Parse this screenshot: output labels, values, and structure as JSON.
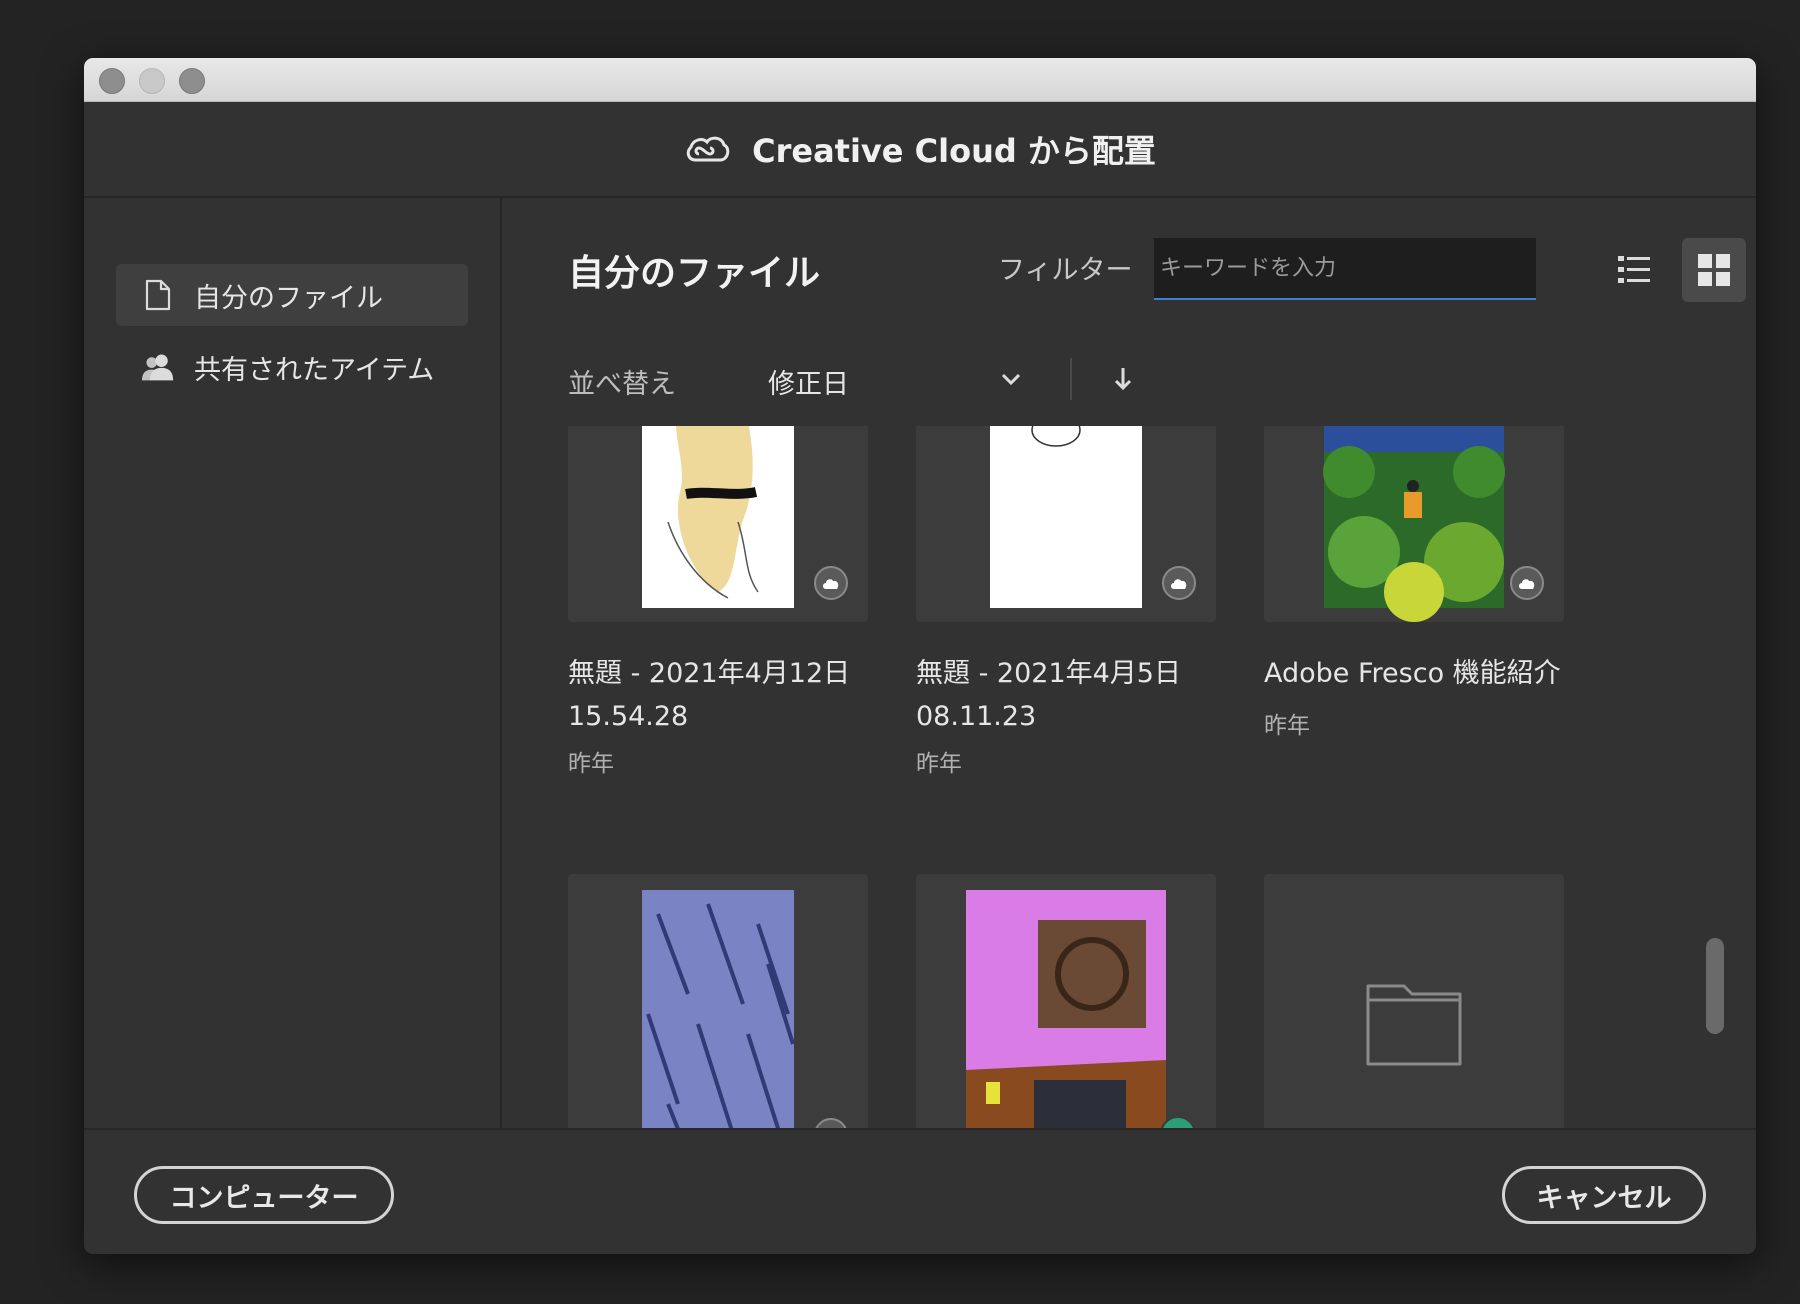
{
  "dialog": {
    "title": "Creative Cloud から配置"
  },
  "sidebar": {
    "items": [
      {
        "label": "自分のファイル",
        "icon": "file-icon",
        "active": true
      },
      {
        "label": "共有されたアイテム",
        "icon": "users-icon",
        "active": false
      }
    ]
  },
  "main": {
    "title": "自分のファイル",
    "filter_label": "フィルター",
    "search_placeholder": "キーワードを入力",
    "view_modes": [
      "list-view-icon",
      "grid-view-icon"
    ],
    "active_view": "grid",
    "sort": {
      "label": "並べ替え",
      "value": "修正日",
      "direction": "descending"
    }
  },
  "files": [
    {
      "name_line1": "無題 - 2021年4月12日",
      "name_line2": "15.54.28",
      "date": "昨年",
      "status": "cloud"
    },
    {
      "name_line1": "無題 - 2021年4月5日",
      "name_line2": "08.11.23",
      "date": "昨年",
      "status": "cloud"
    },
    {
      "name_line1": "Adobe Fresco 機能紹介",
      "name_line2": "",
      "date": "昨年",
      "status": "cloud"
    },
    {
      "name_line1": "",
      "name_line2": "",
      "date": "",
      "status": "cloud"
    },
    {
      "name_line1": "",
      "name_line2": "",
      "date": "",
      "status": "synced"
    },
    {
      "name_line1": "",
      "name_line2": "",
      "date": "",
      "status": "folder"
    }
  ],
  "footer": {
    "computer_label": "コンピューター",
    "cancel_label": "キャンセル"
  },
  "colors": {
    "accent": "#3d7fd6",
    "synced": "#2d9d78",
    "background": "#323232"
  }
}
